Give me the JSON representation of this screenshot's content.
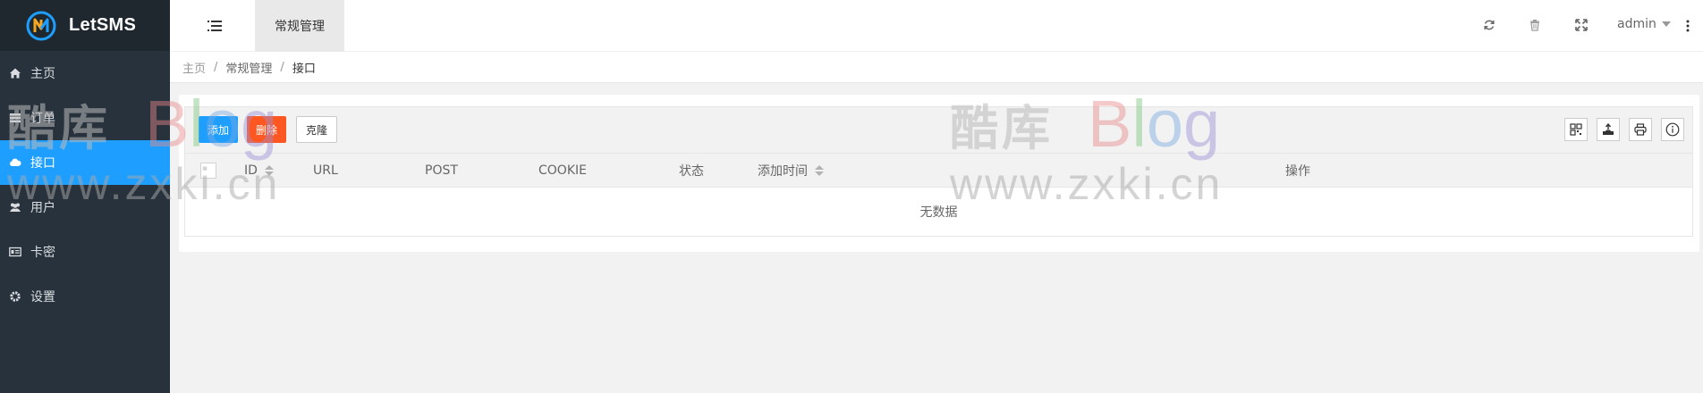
{
  "app": {
    "name": "LetSMS",
    "brand_colors": {
      "accent": "#1e9fff",
      "danger": "#ff5722",
      "sidebar": "#28323c"
    }
  },
  "sidebar": {
    "items": [
      {
        "label": "主页",
        "icon": "home-icon"
      },
      {
        "label": "订单",
        "icon": "list-icon"
      },
      {
        "label": "接口",
        "icon": "cloud-icon",
        "active": true
      },
      {
        "label": "用户",
        "icon": "users-icon"
      },
      {
        "label": "卡密",
        "icon": "card-icon"
      },
      {
        "label": "设置",
        "icon": "gear-icon"
      }
    ]
  },
  "header": {
    "tab_label": "常规管理",
    "user": "admin",
    "icons": [
      "refresh-icon",
      "trash-icon",
      "fullscreen-icon",
      "more-vertical-icon"
    ]
  },
  "breadcrumb": [
    "主页",
    "常规管理",
    "接口"
  ],
  "toolbar": {
    "add_label": "添加",
    "delete_label": "删除",
    "clone_label": "克隆",
    "tool_icons": [
      "columns-icon",
      "export-icon",
      "print-icon",
      "info-icon"
    ]
  },
  "table": {
    "columns": [
      "ID",
      "URL",
      "POST",
      "COOKIE",
      "状态",
      "添加时间",
      "操作"
    ],
    "empty_text": "无数据"
  },
  "watermark": {
    "cn": "酷库",
    "blog": "Blog",
    "url": "www.zxki.cn"
  }
}
